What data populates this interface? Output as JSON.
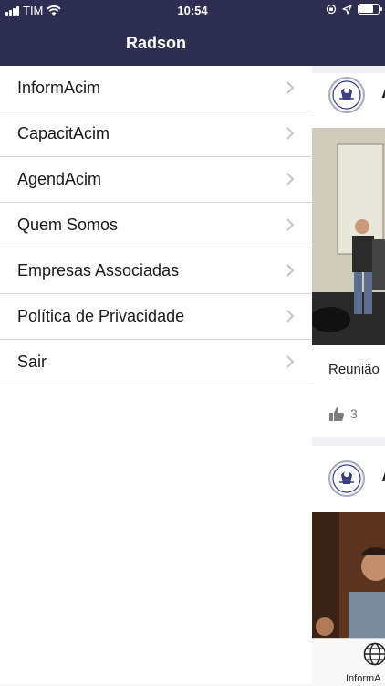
{
  "status_bar": {
    "carrier": "TIM",
    "time": "10:54",
    "battery_level": 0.9
  },
  "drawer": {
    "title": "Radson",
    "items": [
      {
        "label": "InformAcim"
      },
      {
        "label": "CapacitAcim"
      },
      {
        "label": "AgendAcim"
      },
      {
        "label": "Quem Somos"
      },
      {
        "label": "Empresas Associadas"
      },
      {
        "label": "Política de Privacidade"
      },
      {
        "label": "Sair"
      }
    ]
  },
  "feed": {
    "posts": [
      {
        "author_initial": "A",
        "caption": "Reunião",
        "likes": "3"
      },
      {
        "author_initial": "A"
      }
    ],
    "tab_label": "InformA"
  },
  "colors": {
    "header": "#2e2d52",
    "background": "#efeff4",
    "divider": "#d6d6d6"
  }
}
